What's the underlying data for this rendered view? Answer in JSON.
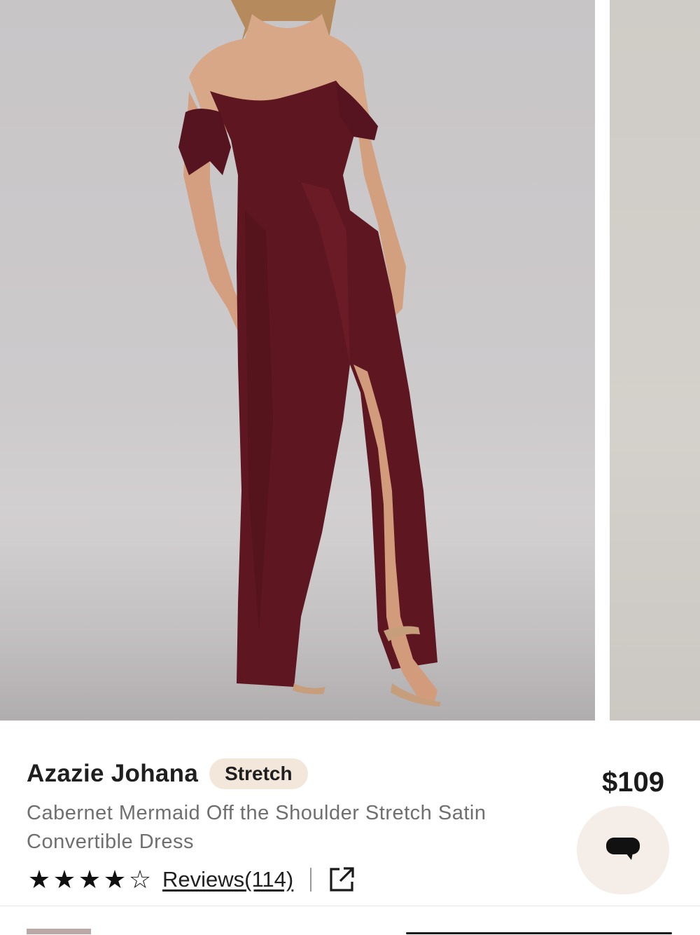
{
  "product": {
    "title": "Azazie Johana",
    "badge": "Stretch",
    "price": "$109",
    "description": "Cabernet Mermaid Off the Shoulder Stretch Satin Convertible Dress",
    "rating": 4.5,
    "rating_max": 5,
    "stars": [
      "★",
      "★",
      "★",
      "★",
      "☆"
    ],
    "reviews_label": "Reviews(114)"
  },
  "colors": {
    "dress": "#5e1620",
    "badge_bg": "#f3e7dc",
    "chat_bg": "#f4ede8"
  },
  "icons": {
    "share": "external-link-icon",
    "chat": "chat-bubble-icon"
  }
}
